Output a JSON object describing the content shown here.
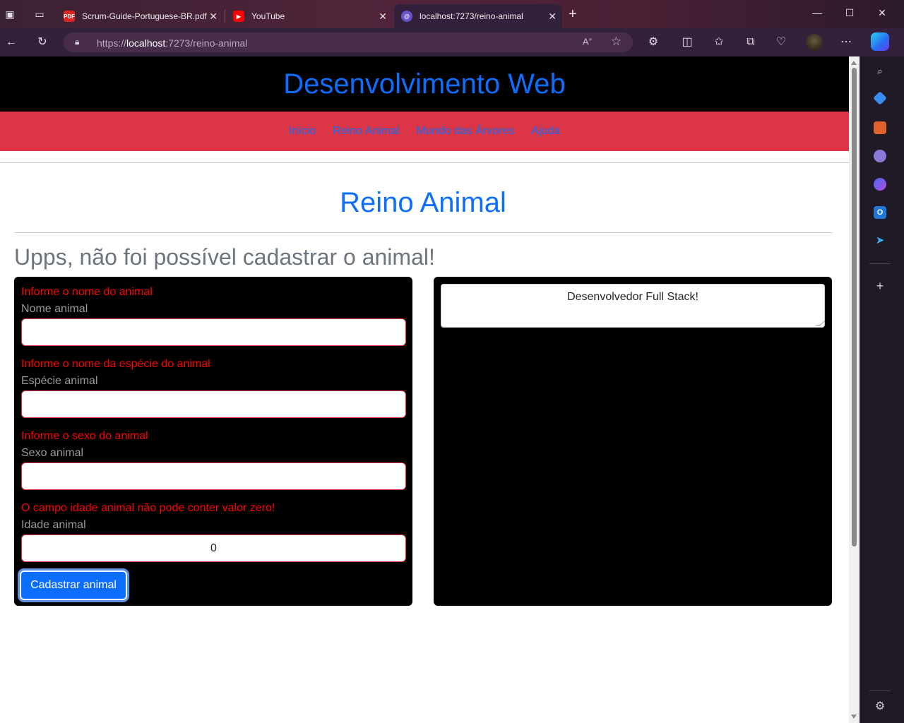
{
  "browser": {
    "tabs": [
      {
        "label": "Scrum-Guide-Portuguese-BR.pdf",
        "icon": "pdf-icon"
      },
      {
        "label": "YouTube",
        "icon": "youtube-icon"
      },
      {
        "label": "localhost:7273/reino-animal",
        "icon": "localhost-icon",
        "active": true
      }
    ],
    "url_prefix": "https://",
    "url_host": "localhost",
    "url_rest": ":7273/reino-animal"
  },
  "site": {
    "title": "Desenvolvimento Web",
    "nav": [
      "Início",
      "Reino Animal",
      "Mundo das Árvores",
      "Ajuda"
    ]
  },
  "page": {
    "title": "Reino Animal",
    "error_heading": "Upps, não foi possível cadastrar o animal!"
  },
  "form": {
    "fields": [
      {
        "error": "Informe o nome do animal",
        "label": "Nome animal",
        "value": ""
      },
      {
        "error": "Informe o nome da espécie do animal",
        "label": "Espécie animal",
        "value": ""
      },
      {
        "error": "Informe o sexo do animal",
        "label": "Sexo animal",
        "value": ""
      },
      {
        "error": "O campo idade animal não pode conter valor zero!",
        "label": "Idade animal",
        "value": "0"
      }
    ],
    "submit_label": "Cadastrar animal"
  },
  "aside": {
    "textarea_value": "Desenvolvedor Full Stack!"
  },
  "colors": {
    "primary": "#0d6efd",
    "danger": "#dc3545",
    "error_text": "#ff0000",
    "header_bg": "#000000"
  }
}
